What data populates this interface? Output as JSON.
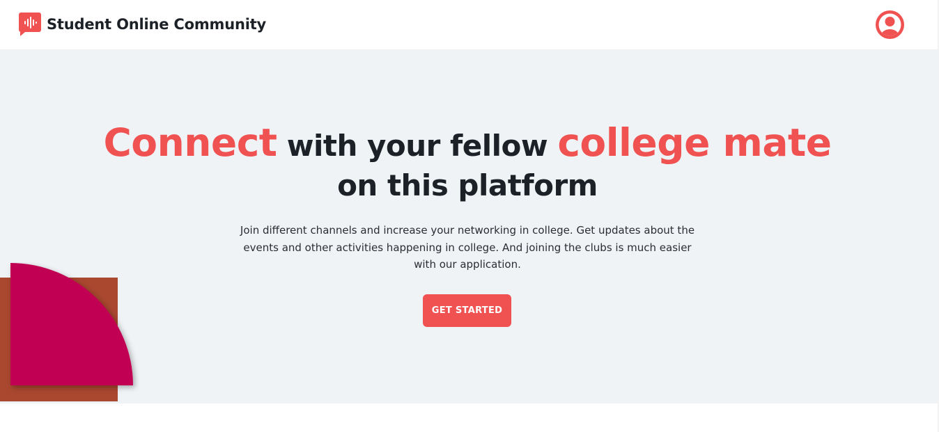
{
  "header": {
    "app_name": "Student Online Community",
    "logo_icon": "chat-audio-wave-icon",
    "profile_icon": "user-circle-icon"
  },
  "hero": {
    "headline": {
      "highlight_1": "Connect",
      "text_1": " with your fellow ",
      "highlight_2": "college mate",
      "text_2": "on this platform"
    },
    "subtitle": "Join different channels and increase your networking in college. Get updates about the events and other activities happening in college. And joining the clubs is much easier with our application.",
    "cta_label": "GET STARTED"
  },
  "colors": {
    "accent": "#f05252",
    "hero_background": "#f0f3f6",
    "text_dark": "#1c2127",
    "deco_magenta": "#c20552",
    "deco_rust": "#a9472f"
  }
}
